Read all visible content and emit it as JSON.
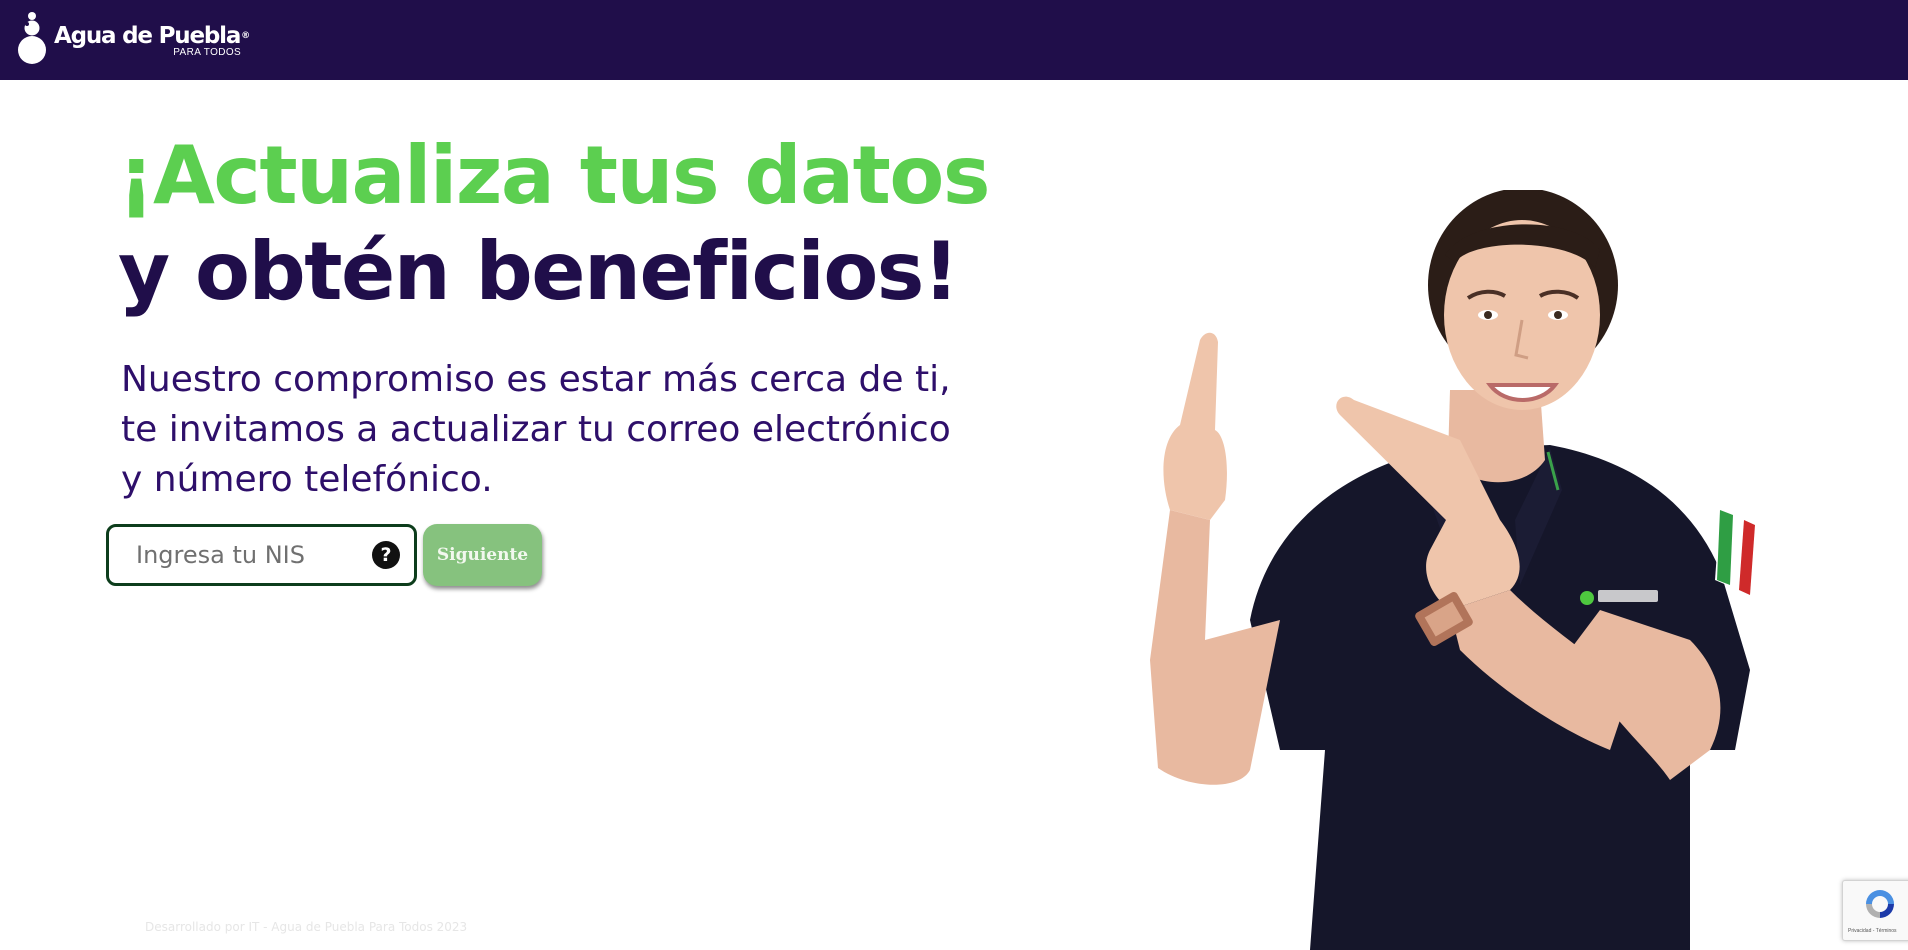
{
  "header": {
    "logo_text": "Agua de Puebla",
    "logo_registered": "®",
    "logo_subtitle": "PARA TODOS"
  },
  "hero": {
    "headline_line1": "¡Actualiza tus datos",
    "headline_line2": "y obtén beneficios!",
    "intro_lines": [
      "Nuestro compromiso es estar más cerca de ti,",
      "te invitamos a actualizar tu correo electrónico",
      "y número telefónico."
    ]
  },
  "form": {
    "nis_placeholder": "Ingresa tu NIS",
    "nis_value": "",
    "help_icon": "question-circle-icon",
    "next_label": "Siguiente"
  },
  "footer": {
    "credit": "Desarrollado por IT - Agua de Puebla Para Todos 2023"
  },
  "recaptcha": {
    "icon": "recaptcha-icon",
    "links": "Privacidad - Términos"
  },
  "colors": {
    "header_bg": "#200e4a",
    "headline_green": "#5ccf50",
    "headline_purple": "#200e4a",
    "body_text": "#2e0f6a",
    "input_border": "#0d3d1c",
    "button_bg": "#86c27e",
    "polo_logo_green": "#4ec73f"
  }
}
